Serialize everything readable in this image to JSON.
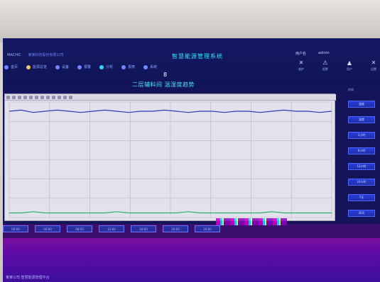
{
  "header": {
    "brand": "MACHIC",
    "brand_sub": "某某科技股份有限公司",
    "app_title": "智慧能源管理系统",
    "user_label": "用户名",
    "user_name": "admin"
  },
  "nav": {
    "items": [
      {
        "label": "首页",
        "icon": "home-icon"
      },
      {
        "label": "能源总览",
        "icon": "energy-icon"
      },
      {
        "label": "设备",
        "icon": "device-icon"
      },
      {
        "label": "报警",
        "icon": "alarm-icon"
      },
      {
        "label": "分析",
        "icon": "analysis-icon"
      },
      {
        "label": "报表",
        "icon": "report-icon"
      },
      {
        "label": "系统",
        "icon": "system-icon"
      }
    ]
  },
  "right_icons": [
    {
      "icon": "tools-icon",
      "label": "维护"
    },
    {
      "icon": "warning-icon",
      "label": "报警"
    },
    {
      "icon": "user-icon",
      "label": "用户"
    },
    {
      "icon": "settings-icon",
      "label": "设置"
    }
  ],
  "page": {
    "title": "二层辅料间 温湿度趋势",
    "center_mark": "8"
  },
  "side_panel": {
    "top_label": "时间",
    "buttons": [
      "温度",
      "湿度",
      "1小时",
      "6小时",
      "12小时",
      "24小时",
      "7天",
      "30天"
    ]
  },
  "bottom_tabs": [
    "00:00",
    "04:00",
    "08:00",
    "12:00",
    "16:00",
    "20:00",
    "24:00"
  ],
  "footer": {
    "text": "某某公司 智慧能源管理平台"
  },
  "chart_data": {
    "type": "line",
    "title": "",
    "xlabel": "",
    "ylabel": "",
    "ylim": [
      0,
      100
    ],
    "grid": true,
    "series": [
      {
        "color": "#2a3cb4",
        "values": [
          92,
          93,
          91,
          92,
          93,
          92,
          91,
          92,
          93,
          92,
          91,
          92,
          92,
          93,
          92,
          91,
          92,
          92,
          91,
          92,
          92,
          91,
          92,
          93,
          92,
          92,
          91,
          92
        ]
      },
      {
        "color": "#2bb06b",
        "values": [
          4,
          4,
          5,
          4,
          4,
          4,
          4,
          4,
          4,
          5,
          4,
          4,
          4,
          4,
          4,
          5,
          4,
          4,
          4,
          4,
          4,
          4,
          5,
          4,
          4,
          4,
          4,
          4
        ]
      }
    ]
  }
}
